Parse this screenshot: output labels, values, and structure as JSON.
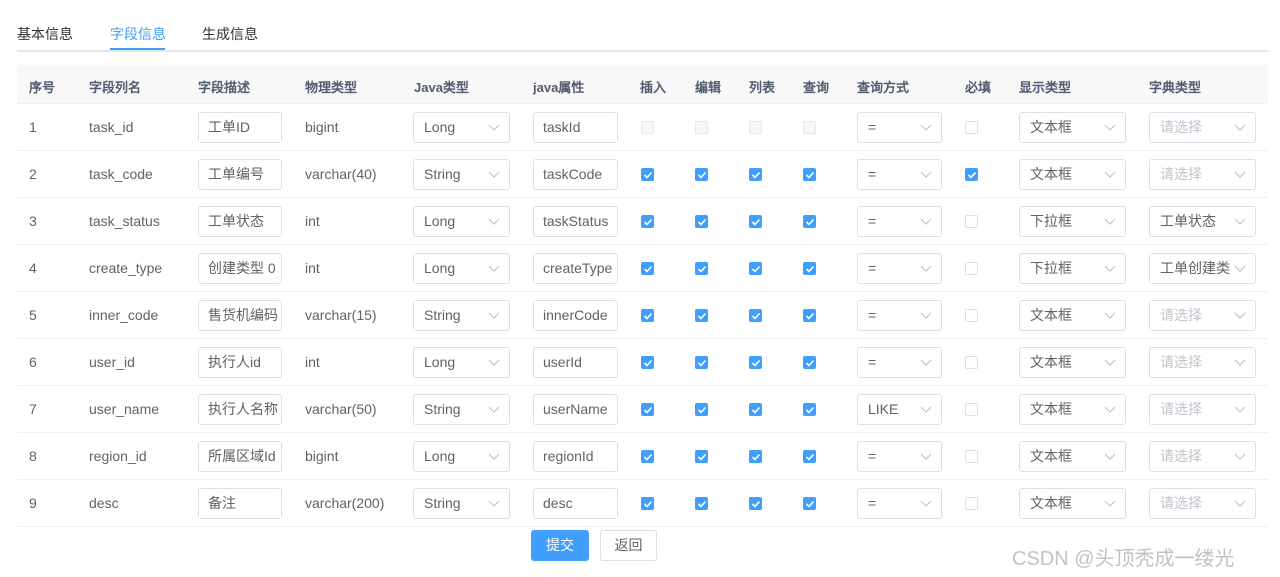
{
  "tabs": [
    {
      "label": "基本信息",
      "active": false
    },
    {
      "label": "字段信息",
      "active": true
    },
    {
      "label": "生成信息",
      "active": false
    }
  ],
  "columns": [
    "序号",
    "字段列名",
    "字段描述",
    "物理类型",
    "Java类型",
    "java属性",
    "插入",
    "编辑",
    "列表",
    "查询",
    "查询方式",
    "必填",
    "显示类型",
    "字典类型"
  ],
  "rows": [
    {
      "index": "1",
      "column_name": "task_id",
      "description": "工单ID",
      "physical_type": "bigint",
      "java_type": "Long",
      "java_field": "taskId",
      "insert": false,
      "edit": false,
      "list": false,
      "query": false,
      "checks_disabled": true,
      "query_type": "=",
      "required": false,
      "display_type": "文本框",
      "dict_type": "请选择",
      "dict_placeholder": true
    },
    {
      "index": "2",
      "column_name": "task_code",
      "description": "工单编号",
      "physical_type": "varchar(40)",
      "java_type": "String",
      "java_field": "taskCode",
      "insert": true,
      "edit": true,
      "list": true,
      "query": true,
      "checks_disabled": false,
      "query_type": "=",
      "required": true,
      "display_type": "文本框",
      "dict_type": "请选择",
      "dict_placeholder": true
    },
    {
      "index": "3",
      "column_name": "task_status",
      "description": "工单状态",
      "physical_type": "int",
      "java_type": "Long",
      "java_field": "taskStatus",
      "insert": true,
      "edit": true,
      "list": true,
      "query": true,
      "checks_disabled": false,
      "query_type": "=",
      "required": false,
      "display_type": "下拉框",
      "dict_type": "工单状态",
      "dict_placeholder": false
    },
    {
      "index": "4",
      "column_name": "create_type",
      "description": "创建类型 0",
      "physical_type": "int",
      "java_type": "Long",
      "java_field": "createType",
      "insert": true,
      "edit": true,
      "list": true,
      "query": true,
      "checks_disabled": false,
      "query_type": "=",
      "required": false,
      "display_type": "下拉框",
      "dict_type": "工单创建类",
      "dict_placeholder": false
    },
    {
      "index": "5",
      "column_name": "inner_code",
      "description": "售货机编码",
      "physical_type": "varchar(15)",
      "java_type": "String",
      "java_field": "innerCode",
      "insert": true,
      "edit": true,
      "list": true,
      "query": true,
      "checks_disabled": false,
      "query_type": "=",
      "required": false,
      "display_type": "文本框",
      "dict_type": "请选择",
      "dict_placeholder": true
    },
    {
      "index": "6",
      "column_name": "user_id",
      "description": "执行人id",
      "physical_type": "int",
      "java_type": "Long",
      "java_field": "userId",
      "insert": true,
      "edit": true,
      "list": true,
      "query": true,
      "checks_disabled": false,
      "query_type": "=",
      "required": false,
      "display_type": "文本框",
      "dict_type": "请选择",
      "dict_placeholder": true
    },
    {
      "index": "7",
      "column_name": "user_name",
      "description": "执行人名称",
      "physical_type": "varchar(50)",
      "java_type": "String",
      "java_field": "userName",
      "insert": true,
      "edit": true,
      "list": true,
      "query": true,
      "checks_disabled": false,
      "query_type": "LIKE",
      "required": false,
      "display_type": "文本框",
      "dict_type": "请选择",
      "dict_placeholder": true
    },
    {
      "index": "8",
      "column_name": "region_id",
      "description": "所属区域Id",
      "physical_type": "bigint",
      "java_type": "Long",
      "java_field": "regionId",
      "insert": true,
      "edit": true,
      "list": true,
      "query": true,
      "checks_disabled": false,
      "query_type": "=",
      "required": false,
      "display_type": "文本框",
      "dict_type": "请选择",
      "dict_placeholder": true
    },
    {
      "index": "9",
      "column_name": "desc",
      "description": "备注",
      "physical_type": "varchar(200)",
      "java_type": "String",
      "java_field": "desc",
      "insert": true,
      "edit": true,
      "list": true,
      "query": true,
      "checks_disabled": false,
      "query_type": "=",
      "required": false,
      "display_type": "文本框",
      "dict_type": "请选择",
      "dict_placeholder": true
    }
  ],
  "buttons": {
    "submit": "提交",
    "back": "返回"
  },
  "watermark": "CSDN @头顶秃成一缕光",
  "colors": {
    "primary": "#409eff",
    "border": "#dcdfe6",
    "header_bg": "#f8f8f9",
    "text": "#606266"
  }
}
